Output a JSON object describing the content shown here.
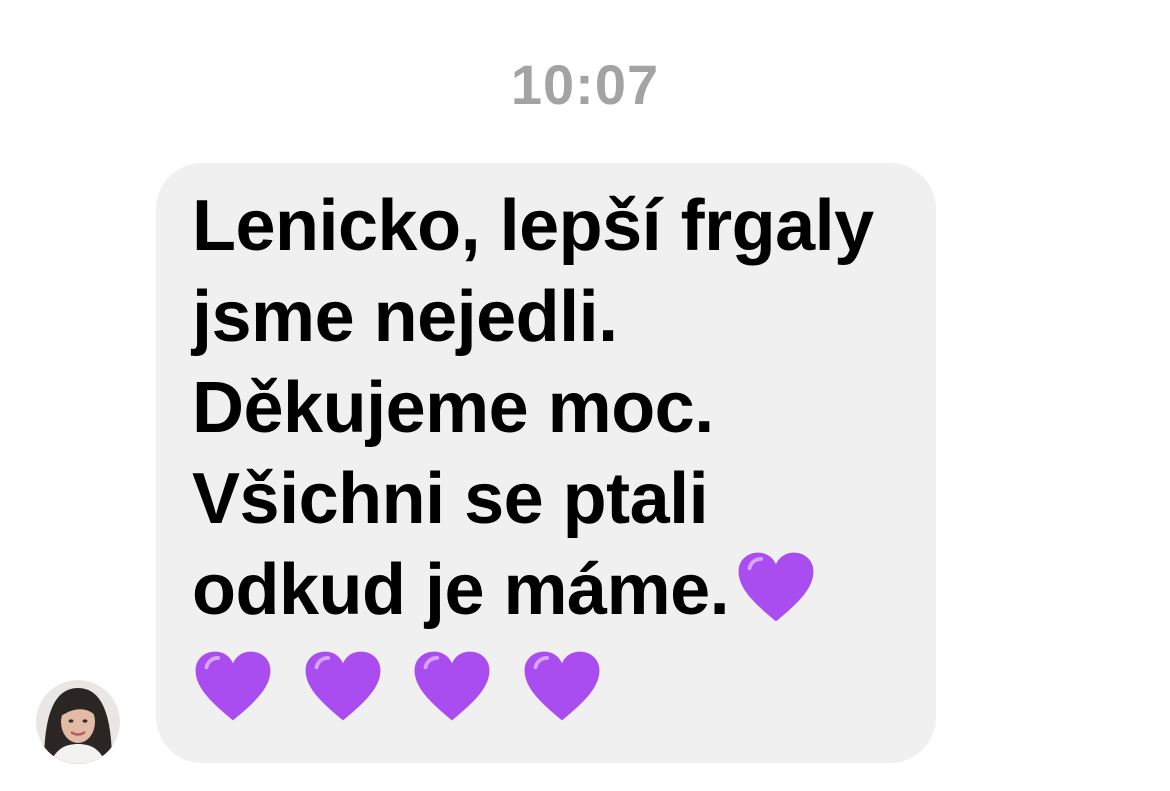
{
  "timestamp": "10:07",
  "avatar": {
    "icon": "avatar-photo"
  },
  "message": {
    "lines": [
      "Lenicko, lepší frgaly",
      "jsme nejedli.",
      "Děkujeme moc.",
      "Všichni se ptali",
      "odkud je máme."
    ],
    "emoji": "purple-heart",
    "emoji_char": "💜",
    "heart_color": "#a94cf0",
    "bubble_color": "#f0f0f0"
  }
}
